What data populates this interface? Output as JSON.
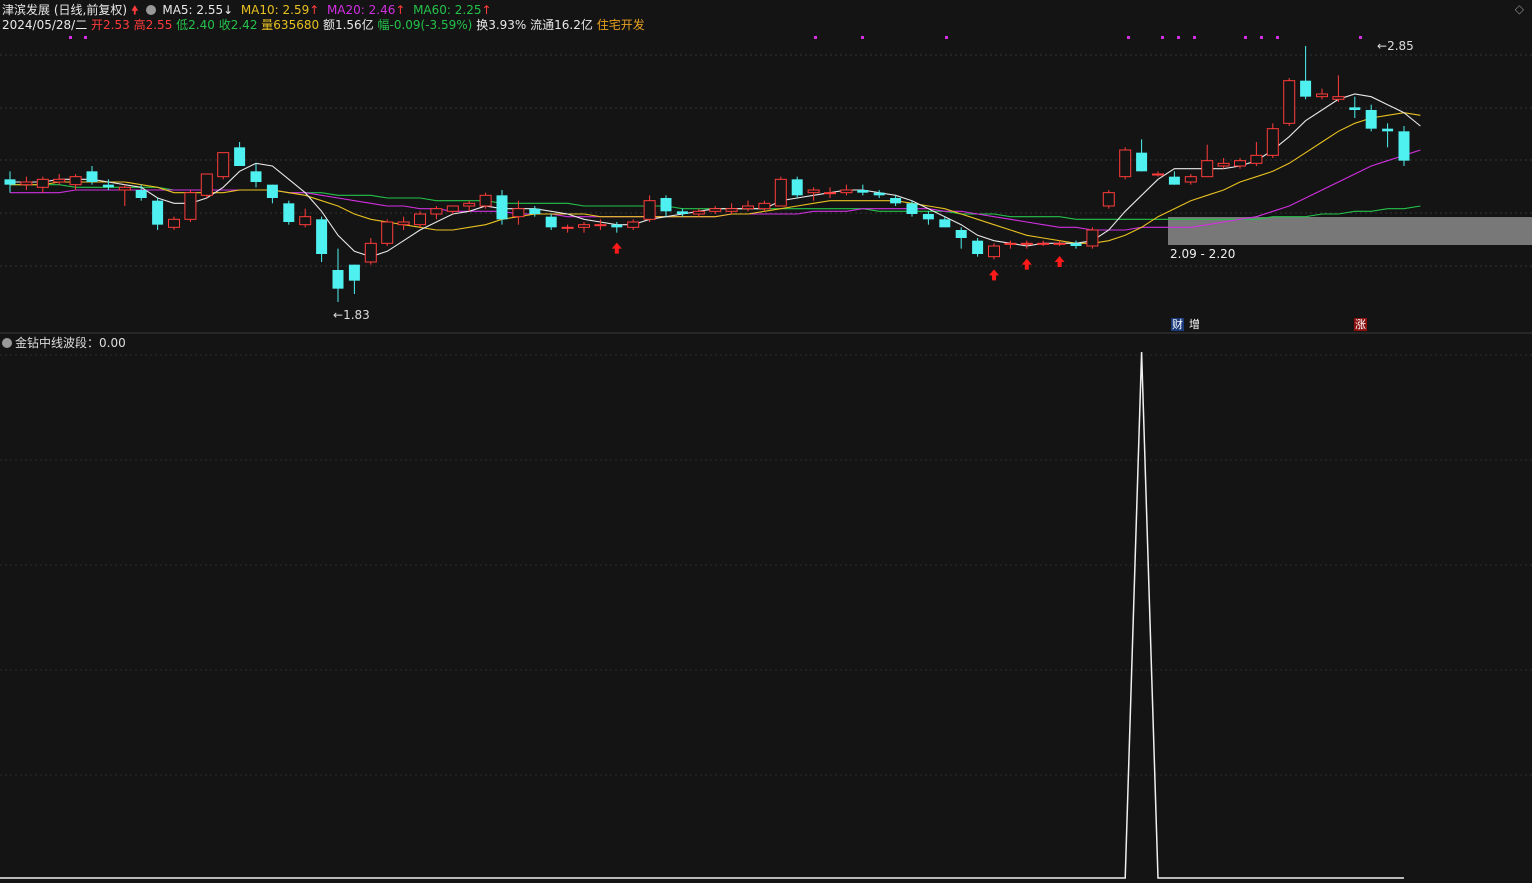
{
  "header": {
    "stock_name": "津滨发展",
    "period": "(日线,前复权)",
    "ma5_label": "MA5: 2.55",
    "ma10_label": "MA10: 2.59",
    "ma20_label": "MA20: 2.46",
    "ma60_label": "MA60: 2.25",
    "date": "2024/05/28/二",
    "open": "开2.53",
    "high": "高2.55",
    "low": "低2.40",
    "close": "收2.42",
    "volume": "量635680",
    "amount": "额1.56亿",
    "change": "幅-0.09(-3.59%)",
    "turnover": "换3.93%",
    "float_cap": "流通16.2亿",
    "sector": "住宅开发"
  },
  "annotations": {
    "low_label": "1.83",
    "high_label": "2.85",
    "range_label": "2.09 - 2.20",
    "badge_cai": "财",
    "badge_zeng": "增",
    "badge_zhang": "涨"
  },
  "indicator": {
    "label": "金钻中线波段：0.00"
  },
  "colors": {
    "up": "#ff3b3b",
    "down": "#4ff0f0",
    "ma5": "#e8e8e8",
    "ma10": "#e8c020",
    "ma20": "#d030e0",
    "ma60": "#24c24a",
    "background": "#141414"
  },
  "icons": [
    "red-up-arrow-icon",
    "settings-circle-icon",
    "diamond-icon"
  ],
  "chart_data": {
    "type": "candlestick",
    "price_range": [
      1.83,
      2.85
    ],
    "candles": [
      {
        "o": 2.35,
        "h": 2.38,
        "l": 2.3,
        "c": 2.33
      },
      {
        "o": 2.33,
        "h": 2.36,
        "l": 2.31,
        "c": 2.34
      },
      {
        "o": 2.32,
        "h": 2.36,
        "l": 2.3,
        "c": 2.35
      },
      {
        "o": 2.34,
        "h": 2.37,
        "l": 2.33,
        "c": 2.35
      },
      {
        "o": 2.33,
        "h": 2.37,
        "l": 2.31,
        "c": 2.36
      },
      {
        "o": 2.38,
        "h": 2.4,
        "l": 2.33,
        "c": 2.34
      },
      {
        "o": 2.33,
        "h": 2.35,
        "l": 2.31,
        "c": 2.32
      },
      {
        "o": 2.31,
        "h": 2.33,
        "l": 2.25,
        "c": 2.32
      },
      {
        "o": 2.31,
        "h": 2.33,
        "l": 2.27,
        "c": 2.28
      },
      {
        "o": 2.27,
        "h": 2.28,
        "l": 2.16,
        "c": 2.18
      },
      {
        "o": 2.17,
        "h": 2.21,
        "l": 2.16,
        "c": 2.2
      },
      {
        "o": 2.2,
        "h": 2.31,
        "l": 2.19,
        "c": 2.3
      },
      {
        "o": 2.29,
        "h": 2.37,
        "l": 2.28,
        "c": 2.37
      },
      {
        "o": 2.36,
        "h": 2.45,
        "l": 2.35,
        "c": 2.45
      },
      {
        "o": 2.47,
        "h": 2.49,
        "l": 2.4,
        "c": 2.4
      },
      {
        "o": 2.38,
        "h": 2.41,
        "l": 2.32,
        "c": 2.34
      },
      {
        "o": 2.33,
        "h": 2.33,
        "l": 2.26,
        "c": 2.28
      },
      {
        "o": 2.26,
        "h": 2.27,
        "l": 2.18,
        "c": 2.19
      },
      {
        "o": 2.18,
        "h": 2.24,
        "l": 2.17,
        "c": 2.21
      },
      {
        "o": 2.2,
        "h": 2.21,
        "l": 2.04,
        "c": 2.07
      },
      {
        "o": 2.01,
        "h": 2.09,
        "l": 1.89,
        "c": 1.94
      },
      {
        "o": 2.03,
        "h": 2.03,
        "l": 1.92,
        "c": 1.97
      },
      {
        "o": 2.04,
        "h": 2.13,
        "l": 2.03,
        "c": 2.11
      },
      {
        "o": 2.11,
        "h": 2.2,
        "l": 2.1,
        "c": 2.19
      },
      {
        "o": 2.18,
        "h": 2.21,
        "l": 2.16,
        "c": 2.19
      },
      {
        "o": 2.18,
        "h": 2.23,
        "l": 2.17,
        "c": 2.22
      },
      {
        "o": 2.22,
        "h": 2.25,
        "l": 2.2,
        "c": 2.24
      },
      {
        "o": 2.23,
        "h": 2.25,
        "l": 2.22,
        "c": 2.25
      },
      {
        "o": 2.25,
        "h": 2.27,
        "l": 2.23,
        "c": 2.26
      },
      {
        "o": 2.25,
        "h": 2.3,
        "l": 2.24,
        "c": 2.29
      },
      {
        "o": 2.29,
        "h": 2.31,
        "l": 2.18,
        "c": 2.2
      },
      {
        "o": 2.21,
        "h": 2.27,
        "l": 2.18,
        "c": 2.24
      },
      {
        "o": 2.24,
        "h": 2.25,
        "l": 2.21,
        "c": 2.22
      },
      {
        "o": 2.21,
        "h": 2.22,
        "l": 2.16,
        "c": 2.17
      },
      {
        "o": 2.17,
        "h": 2.18,
        "l": 2.15,
        "c": 2.17
      },
      {
        "o": 2.17,
        "h": 2.19,
        "l": 2.15,
        "c": 2.18
      },
      {
        "o": 2.18,
        "h": 2.2,
        "l": 2.16,
        "c": 2.18
      },
      {
        "o": 2.18,
        "h": 2.19,
        "l": 2.15,
        "c": 2.17
      },
      {
        "o": 2.17,
        "h": 2.2,
        "l": 2.16,
        "c": 2.19
      },
      {
        "o": 2.2,
        "h": 2.29,
        "l": 2.19,
        "c": 2.27
      },
      {
        "o": 2.28,
        "h": 2.29,
        "l": 2.21,
        "c": 2.23
      },
      {
        "o": 2.23,
        "h": 2.24,
        "l": 2.21,
        "c": 2.22
      },
      {
        "o": 2.22,
        "h": 2.24,
        "l": 2.21,
        "c": 2.23
      },
      {
        "o": 2.23,
        "h": 2.25,
        "l": 2.22,
        "c": 2.24
      },
      {
        "o": 2.23,
        "h": 2.26,
        "l": 2.22,
        "c": 2.24
      },
      {
        "o": 2.24,
        "h": 2.27,
        "l": 2.23,
        "c": 2.25
      },
      {
        "o": 2.24,
        "h": 2.27,
        "l": 2.23,
        "c": 2.26
      },
      {
        "o": 2.25,
        "h": 2.36,
        "l": 2.25,
        "c": 2.35
      },
      {
        "o": 2.35,
        "h": 2.36,
        "l": 2.28,
        "c": 2.29
      },
      {
        "o": 2.3,
        "h": 2.32,
        "l": 2.27,
        "c": 2.31
      },
      {
        "o": 2.3,
        "h": 2.32,
        "l": 2.28,
        "c": 2.3
      },
      {
        "o": 2.3,
        "h": 2.33,
        "l": 2.29,
        "c": 2.31
      },
      {
        "o": 2.31,
        "h": 2.33,
        "l": 2.29,
        "c": 2.3
      },
      {
        "o": 2.3,
        "h": 2.31,
        "l": 2.28,
        "c": 2.29
      },
      {
        "o": 2.28,
        "h": 2.29,
        "l": 2.25,
        "c": 2.26
      },
      {
        "o": 2.26,
        "h": 2.27,
        "l": 2.21,
        "c": 2.22
      },
      {
        "o": 2.22,
        "h": 2.23,
        "l": 2.18,
        "c": 2.2
      },
      {
        "o": 2.2,
        "h": 2.21,
        "l": 2.17,
        "c": 2.17
      },
      {
        "o": 2.16,
        "h": 2.17,
        "l": 2.09,
        "c": 2.13
      },
      {
        "o": 2.12,
        "h": 2.13,
        "l": 2.06,
        "c": 2.07
      },
      {
        "o": 2.06,
        "h": 2.11,
        "l": 2.05,
        "c": 2.1
      },
      {
        "o": 2.11,
        "h": 2.12,
        "l": 2.09,
        "c": 2.11
      },
      {
        "o": 2.11,
        "h": 2.12,
        "l": 2.09,
        "c": 2.11
      },
      {
        "o": 2.11,
        "h": 2.12,
        "l": 2.1,
        "c": 2.11
      },
      {
        "o": 2.11,
        "h": 2.12,
        "l": 2.1,
        "c": 2.11
      },
      {
        "o": 2.11,
        "h": 2.12,
        "l": 2.09,
        "c": 2.1
      },
      {
        "o": 2.1,
        "h": 2.17,
        "l": 2.09,
        "c": 2.16
      },
      {
        "o": 2.25,
        "h": 2.31,
        "l": 2.24,
        "c": 2.3
      },
      {
        "o": 2.36,
        "h": 2.47,
        "l": 2.35,
        "c": 2.46
      },
      {
        "o": 2.45,
        "h": 2.5,
        "l": 2.38,
        "c": 2.38
      },
      {
        "o": 2.37,
        "h": 2.38,
        "l": 2.36,
        "c": 2.37
      },
      {
        "o": 2.36,
        "h": 2.38,
        "l": 2.33,
        "c": 2.33
      },
      {
        "o": 2.34,
        "h": 2.37,
        "l": 2.33,
        "c": 2.36
      },
      {
        "o": 2.36,
        "h": 2.48,
        "l": 2.36,
        "c": 2.42
      },
      {
        "o": 2.4,
        "h": 2.43,
        "l": 2.39,
        "c": 2.41
      },
      {
        "o": 2.4,
        "h": 2.43,
        "l": 2.39,
        "c": 2.42
      },
      {
        "o": 2.41,
        "h": 2.49,
        "l": 2.4,
        "c": 2.44
      },
      {
        "o": 2.44,
        "h": 2.56,
        "l": 2.43,
        "c": 2.54
      },
      {
        "o": 2.56,
        "h": 2.73,
        "l": 2.55,
        "c": 2.72
      },
      {
        "o": 2.72,
        "h": 2.85,
        "l": 2.65,
        "c": 2.66
      },
      {
        "o": 2.66,
        "h": 2.69,
        "l": 2.65,
        "c": 2.67
      },
      {
        "o": 2.65,
        "h": 2.74,
        "l": 2.64,
        "c": 2.66
      },
      {
        "o": 2.62,
        "h": 2.66,
        "l": 2.58,
        "c": 2.61
      },
      {
        "o": 2.61,
        "h": 2.63,
        "l": 2.53,
        "c": 2.54
      },
      {
        "o": 2.54,
        "h": 2.56,
        "l": 2.47,
        "c": 2.53
      },
      {
        "o": 2.53,
        "h": 2.55,
        "l": 2.4,
        "c": 2.42
      }
    ],
    "ma5": [
      2.34,
      2.34,
      2.34,
      2.35,
      2.35,
      2.35,
      2.34,
      2.33,
      2.32,
      2.28,
      2.26,
      2.26,
      2.28,
      2.32,
      2.38,
      2.41,
      2.4,
      2.35,
      2.3,
      2.23,
      2.14,
      2.08,
      2.06,
      2.08,
      2.12,
      2.16,
      2.19,
      2.22,
      2.23,
      2.25,
      2.24,
      2.24,
      2.24,
      2.23,
      2.22,
      2.2,
      2.19,
      2.18,
      2.18,
      2.2,
      2.21,
      2.22,
      2.23,
      2.24,
      2.24,
      2.24,
      2.24,
      2.27,
      2.28,
      2.29,
      2.3,
      2.31,
      2.31,
      2.3,
      2.29,
      2.27,
      2.24,
      2.21,
      2.18,
      2.14,
      2.12,
      2.11,
      2.1,
      2.11,
      2.11,
      2.11,
      2.12,
      2.16,
      2.23,
      2.29,
      2.35,
      2.39,
      2.39,
      2.39,
      2.39,
      2.4,
      2.42,
      2.46,
      2.51,
      2.57,
      2.61,
      2.65,
      2.67,
      2.66,
      2.63,
      2.6,
      2.55
    ],
    "ma10": [
      2.33,
      2.33,
      2.33,
      2.34,
      2.34,
      2.34,
      2.34,
      2.34,
      2.33,
      2.32,
      2.3,
      2.3,
      2.3,
      2.3,
      2.31,
      2.31,
      2.31,
      2.3,
      2.29,
      2.27,
      2.25,
      2.22,
      2.2,
      2.19,
      2.18,
      2.17,
      2.16,
      2.16,
      2.17,
      2.18,
      2.2,
      2.21,
      2.22,
      2.22,
      2.22,
      2.22,
      2.21,
      2.21,
      2.21,
      2.21,
      2.21,
      2.21,
      2.21,
      2.21,
      2.22,
      2.22,
      2.23,
      2.24,
      2.25,
      2.26,
      2.27,
      2.27,
      2.27,
      2.27,
      2.27,
      2.26,
      2.25,
      2.24,
      2.22,
      2.2,
      2.18,
      2.16,
      2.14,
      2.13,
      2.12,
      2.11,
      2.11,
      2.12,
      2.14,
      2.17,
      2.21,
      2.24,
      2.27,
      2.29,
      2.31,
      2.34,
      2.36,
      2.38,
      2.41,
      2.45,
      2.49,
      2.53,
      2.56,
      2.58,
      2.59,
      2.6,
      2.59
    ],
    "ma20": [
      2.3,
      2.3,
      2.3,
      2.3,
      2.31,
      2.31,
      2.31,
      2.31,
      2.31,
      2.31,
      2.31,
      2.31,
      2.31,
      2.31,
      2.31,
      2.31,
      2.31,
      2.3,
      2.3,
      2.29,
      2.28,
      2.27,
      2.26,
      2.25,
      2.25,
      2.24,
      2.24,
      2.23,
      2.23,
      2.23,
      2.23,
      2.22,
      2.22,
      2.22,
      2.21,
      2.21,
      2.21,
      2.21,
      2.21,
      2.21,
      2.21,
      2.21,
      2.21,
      2.21,
      2.22,
      2.22,
      2.22,
      2.22,
      2.22,
      2.23,
      2.23,
      2.23,
      2.24,
      2.24,
      2.24,
      2.24,
      2.24,
      2.23,
      2.23,
      2.22,
      2.21,
      2.2,
      2.19,
      2.18,
      2.17,
      2.17,
      2.16,
      2.16,
      2.16,
      2.17,
      2.17,
      2.17,
      2.17,
      2.18,
      2.19,
      2.2,
      2.21,
      2.23,
      2.25,
      2.28,
      2.31,
      2.34,
      2.37,
      2.4,
      2.42,
      2.44,
      2.46
    ],
    "ma60": [
      2.33,
      2.33,
      2.33,
      2.33,
      2.32,
      2.32,
      2.32,
      2.32,
      2.32,
      2.32,
      2.31,
      2.31,
      2.31,
      2.31,
      2.31,
      2.31,
      2.31,
      2.3,
      2.3,
      2.3,
      2.29,
      2.29,
      2.29,
      2.28,
      2.28,
      2.28,
      2.27,
      2.27,
      2.27,
      2.27,
      2.26,
      2.26,
      2.26,
      2.26,
      2.26,
      2.25,
      2.25,
      2.25,
      2.25,
      2.25,
      2.25,
      2.24,
      2.24,
      2.24,
      2.24,
      2.24,
      2.24,
      2.24,
      2.24,
      2.24,
      2.24,
      2.24,
      2.24,
      2.23,
      2.23,
      2.23,
      2.23,
      2.23,
      2.22,
      2.22,
      2.22,
      2.21,
      2.21,
      2.21,
      2.21,
      2.2,
      2.2,
      2.2,
      2.2,
      2.2,
      2.2,
      2.2,
      2.2,
      2.2,
      2.2,
      2.2,
      2.2,
      2.21,
      2.21,
      2.21,
      2.22,
      2.22,
      2.23,
      2.23,
      2.24,
      2.24,
      2.25
    ],
    "indicator_values_nonzero": [
      {
        "index": 69,
        "value": 1.0
      }
    ],
    "buy_arrows": [
      37,
      60,
      62,
      64
    ]
  }
}
